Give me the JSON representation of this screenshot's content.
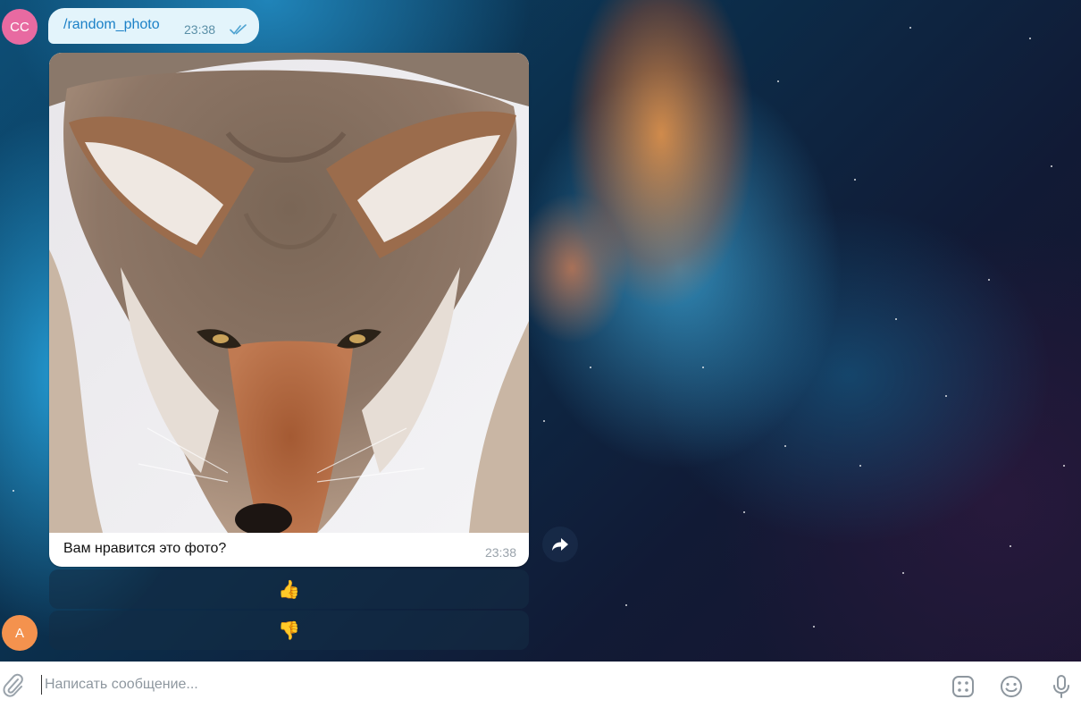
{
  "colors": {
    "cmd_bubble_bg": "#e3f4fb",
    "cmd_text": "#1c81c7",
    "avatar_cc": "#e86aa1",
    "avatar_a": "#f4924e"
  },
  "avatars": {
    "sender_initials": "CC",
    "bot_initials": "A"
  },
  "outgoing": {
    "command": "/random_photo",
    "time": "23:38",
    "status_icon": "double-check-icon"
  },
  "incoming": {
    "photo_alt": "coyote",
    "caption": "Вам нравится это фото?",
    "time": "23:38",
    "forward_icon": "forward-arrow-icon"
  },
  "keyboard": {
    "buttons": [
      {
        "label": "👍"
      },
      {
        "label": "👎"
      }
    ]
  },
  "composer": {
    "placeholder": "Написать сообщение...",
    "value": "",
    "icons": [
      "paperclip-icon",
      "bot-commands-icon",
      "emoji-icon",
      "microphone-icon"
    ]
  }
}
